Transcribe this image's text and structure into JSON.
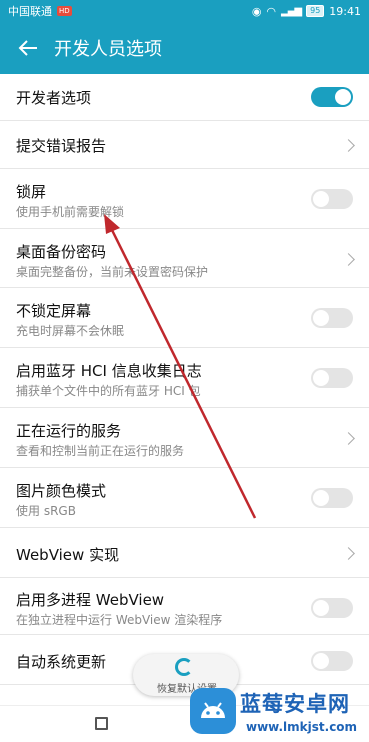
{
  "status_bar": {
    "carrier": "中国联通",
    "network_badge": "HD",
    "battery": "95",
    "time": "19:41",
    "icons": [
      "eye-icon",
      "wifi-icon",
      "signal-icon",
      "battery-icon"
    ]
  },
  "app_bar": {
    "title": "开发人员选项",
    "back_icon": "back-arrow-icon"
  },
  "settings": [
    {
      "label": "开发者选项",
      "subtitle": "",
      "control": "toggle",
      "on": true
    },
    {
      "label": "提交错误报告",
      "subtitle": "",
      "control": "chevron"
    },
    {
      "label": "锁屏",
      "subtitle": "使用手机前需要解锁",
      "control": "toggle",
      "on": false
    },
    {
      "label": "桌面备份密码",
      "subtitle": "桌面完整备份，当前未设置密码保护",
      "control": "chevron"
    },
    {
      "label": "不锁定屏幕",
      "subtitle": "充电时屏幕不会休眠",
      "control": "toggle",
      "on": false
    },
    {
      "label": "启用蓝牙 HCI 信息收集日志",
      "subtitle": "捕获单个文件中的所有蓝牙 HCI 包",
      "control": "toggle",
      "on": false
    },
    {
      "label": "正在运行的服务",
      "subtitle": "查看和控制当前正在运行的服务",
      "control": "chevron"
    },
    {
      "label": "图片颜色模式",
      "subtitle": "使用 sRGB",
      "control": "toggle",
      "on": false
    },
    {
      "label": "WebView 实现",
      "subtitle": "",
      "control": "chevron"
    },
    {
      "label": "启用多进程 WebView",
      "subtitle": "在独立进程中运行 WebView 渲染程序",
      "control": "toggle",
      "on": false
    },
    {
      "label": "自动系统更新",
      "subtitle": "",
      "control": "toggle",
      "on": false
    }
  ],
  "restore_button": {
    "label": "恢复默认设置"
  },
  "watermark": {
    "name": "蓝莓安卓网",
    "url": "www.lmkjst.com"
  },
  "colors": {
    "accent": "#1a9fc0",
    "annotation_arrow": "#c0282d",
    "watermark": "#1e63b6"
  }
}
